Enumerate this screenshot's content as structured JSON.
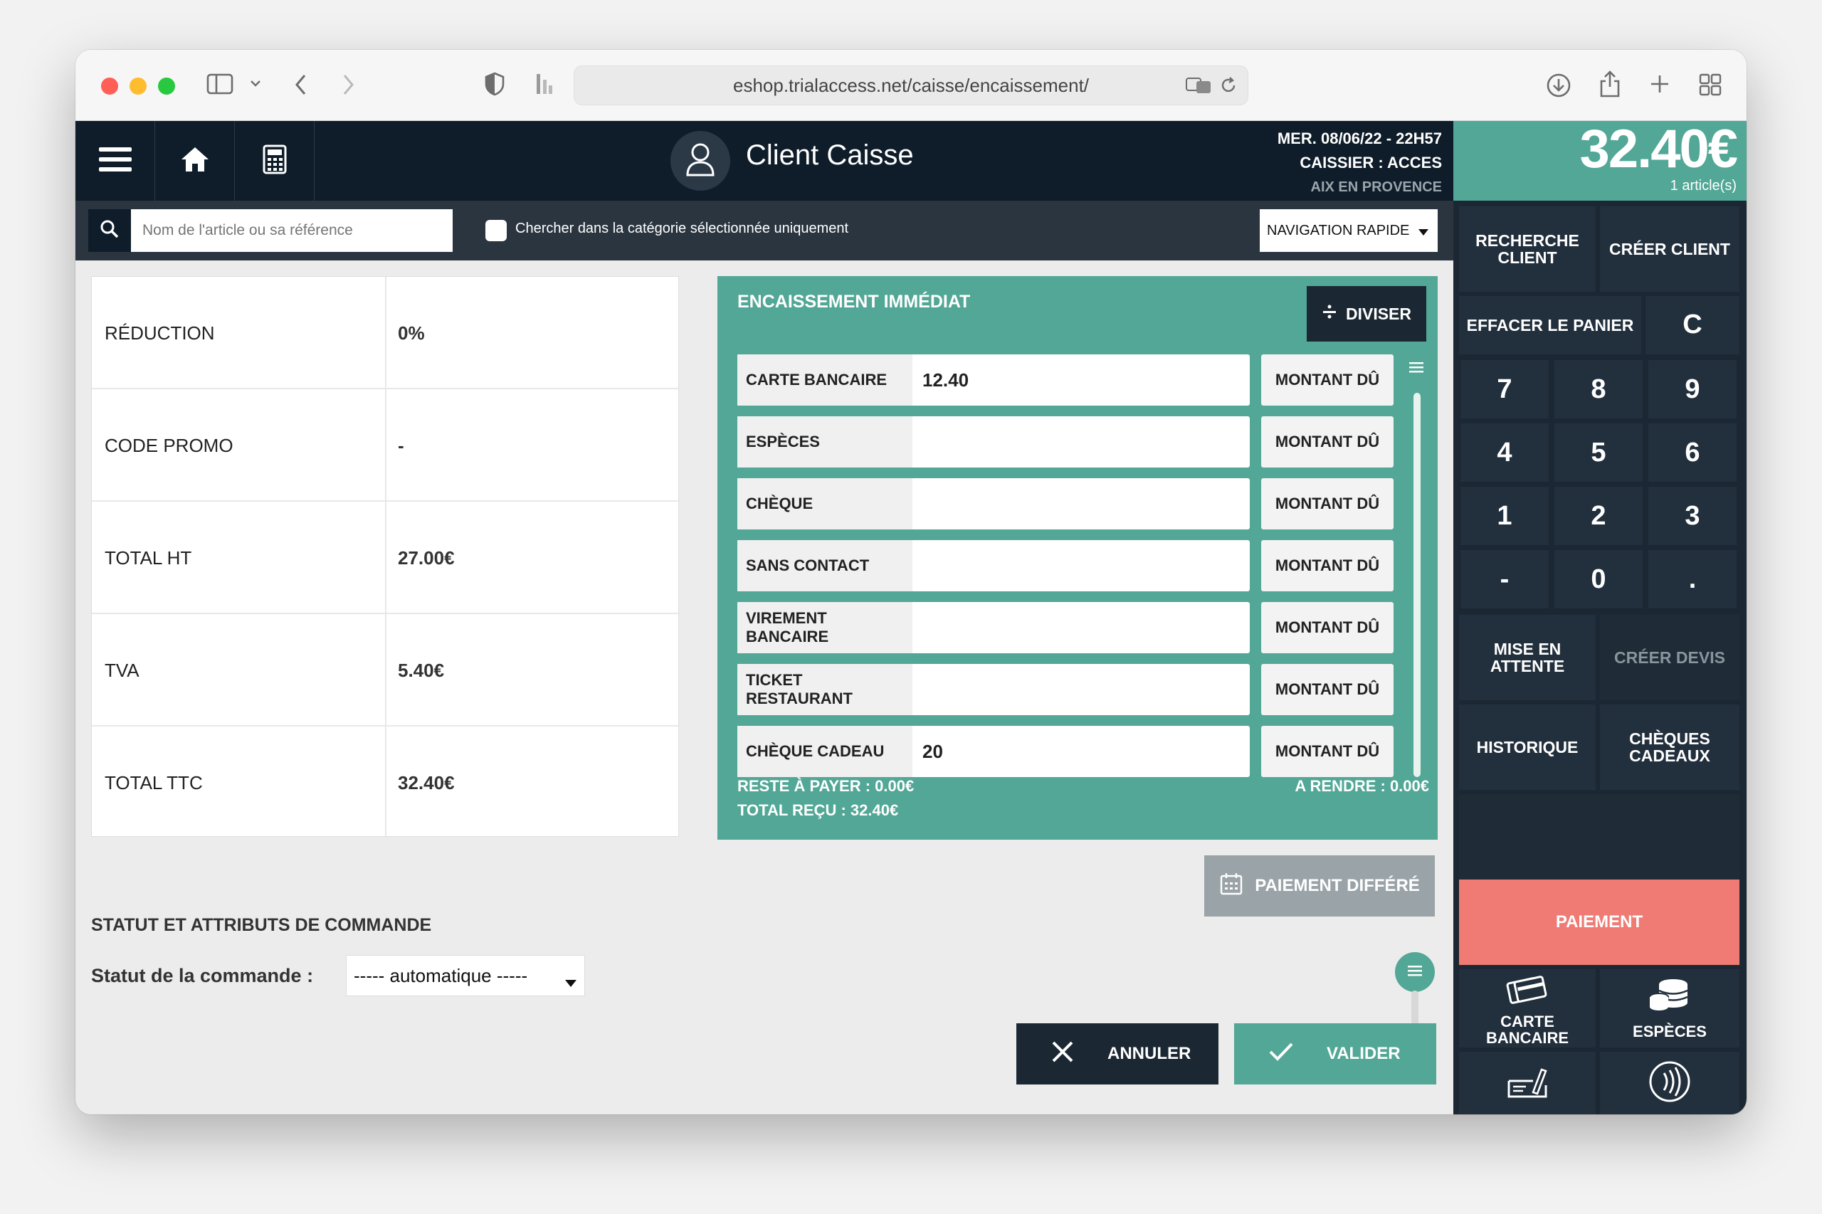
{
  "browser": {
    "url": "eshop.trialaccess.net/caisse/encaissement/"
  },
  "header": {
    "title": "Client Caisse",
    "date": "MER. 08/06/22 - 22H57",
    "cashier": "CAISSIER : ACCES",
    "location": "AIX EN PROVENCE"
  },
  "totals": {
    "amount": "32.40€",
    "articles": "1 article(s)"
  },
  "search": {
    "placeholder": "Nom de l'article ou sa référence",
    "category_label": "Chercher dans la catégorie sélectionnée uniquement",
    "nav": "NAVIGATION RAPIDE"
  },
  "summary": [
    {
      "label": "RÉDUCTION",
      "value": "0%"
    },
    {
      "label": "CODE PROMO",
      "value": "-"
    },
    {
      "label": "TOTAL HT",
      "value": "27.00€"
    },
    {
      "label": "TVA",
      "value": "5.40€"
    },
    {
      "label": "TOTAL TTC",
      "value": "32.40€"
    }
  ],
  "payment": {
    "title": "ENCAISSEMENT IMMÉDIAT",
    "split": "DIVISER",
    "due_label": "MONTANT DÛ",
    "methods": [
      {
        "label": "CARTE BANCAIRE",
        "value": "12.40"
      },
      {
        "label": "ESPÈCES",
        "value": ""
      },
      {
        "label": "CHÈQUE",
        "value": ""
      },
      {
        "label": "SANS CONTACT",
        "value": ""
      },
      {
        "label": "VIREMENT BANCAIRE",
        "value": ""
      },
      {
        "label": "TICKET RESTAURANT",
        "value": ""
      },
      {
        "label": "CHÈQUE CADEAU",
        "value": "20"
      }
    ],
    "remaining": "RESTE À PAYER : 0.00€",
    "received": "TOTAL REÇU : 32.40€",
    "change": "A RENDRE : 0.00€",
    "deferred": "PAIEMENT DIFFÉRÉ"
  },
  "order": {
    "section_title": "STATUT ET ATTRIBUTS DE COMMANDE",
    "status_label": "Statut de la commande :",
    "status_value": "----- automatique -----"
  },
  "actions": {
    "cancel": "ANNULER",
    "validate": "VALIDER"
  },
  "side": {
    "search_client_l1": "RECHERCHE",
    "search_client_l2": "CLIENT",
    "create_client": "CRÉER CLIENT",
    "clear_cart": "EFFACER LE PANIER",
    "clear_key": "C",
    "keys": [
      "7",
      "8",
      "9",
      "4",
      "5",
      "6",
      "1",
      "2",
      "3",
      "-",
      "0",
      "."
    ],
    "hold_l1": "MISE EN",
    "hold_l2": "ATTENTE",
    "quote": "CRÉER DEVIS",
    "history": "HISTORIQUE",
    "gift_l1": "CHÈQUES",
    "gift_l2": "CADEAUX",
    "pay": "PAIEMENT",
    "card_l1": "CARTE",
    "card_l2": "BANCAIRE",
    "cash": "ESPÈCES"
  },
  "colors": {
    "navy": "#0f1d2a",
    "teal": "#52a796",
    "salmon": "#ef7b74",
    "gray_btn": "#9aa3a8"
  }
}
